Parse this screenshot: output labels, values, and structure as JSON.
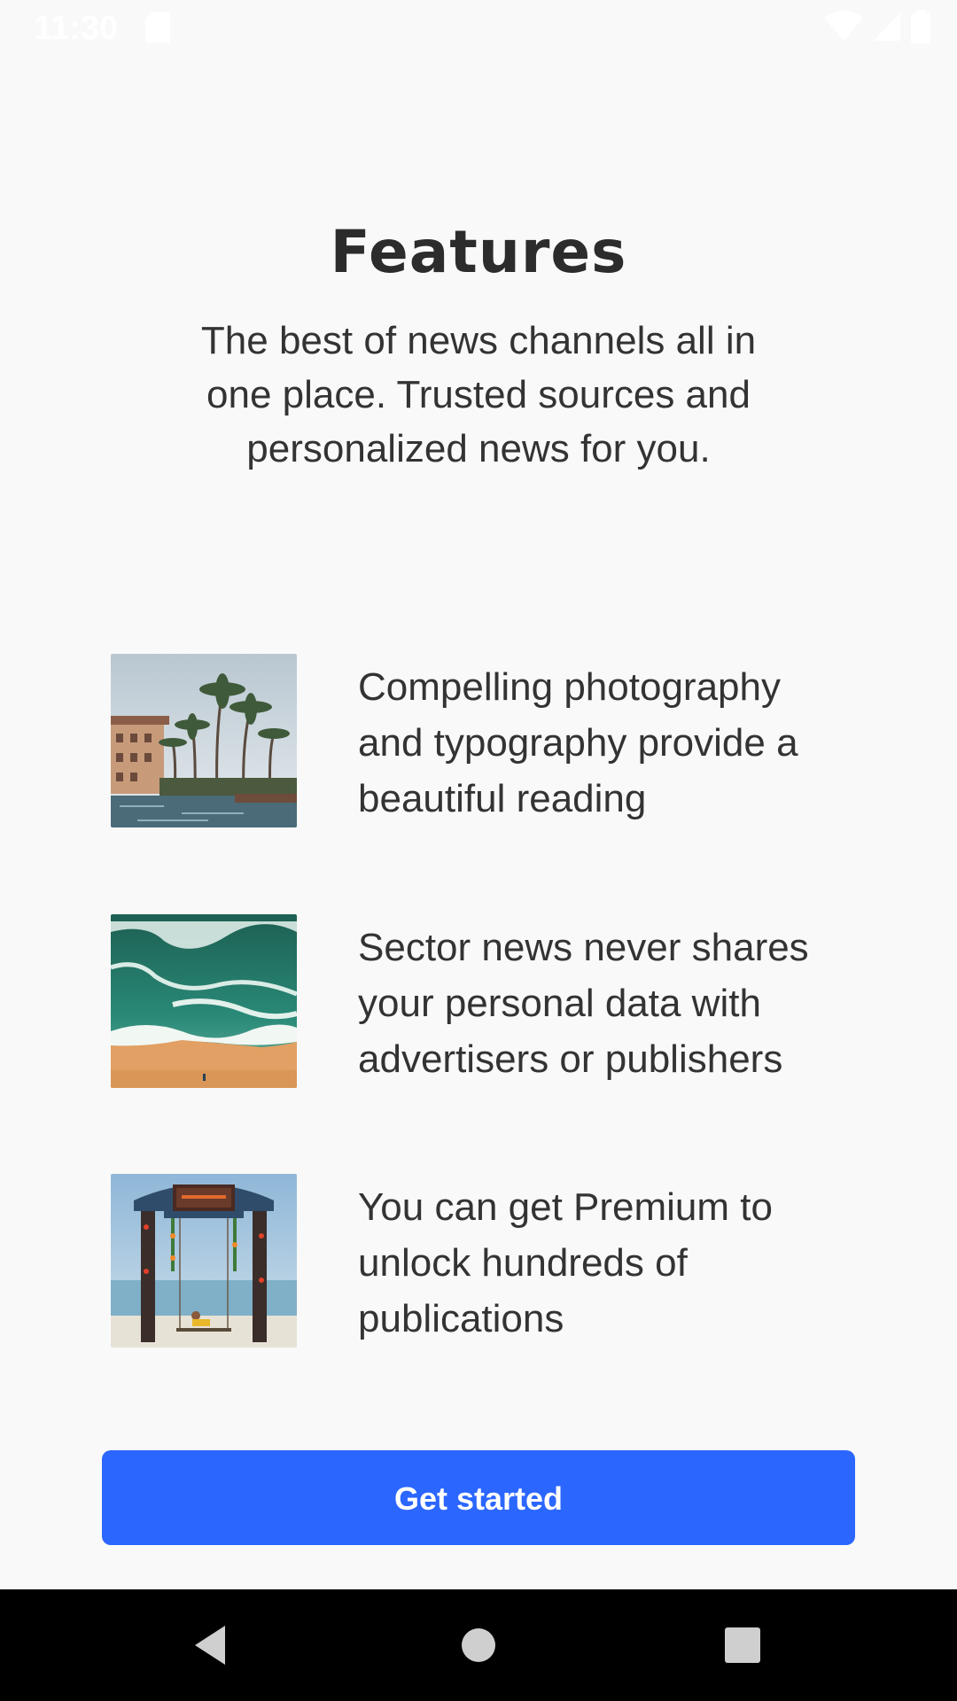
{
  "status_bar": {
    "time": "11:30",
    "icons": [
      "sd-card-icon",
      "wifi-icon",
      "signal-icon",
      "battery-icon"
    ]
  },
  "header": {
    "title": "Features",
    "subtitle": "The best of news channels all in one place. Trusted sources and personalized news for you."
  },
  "features": [
    {
      "image": "resort-palms-pool-photo",
      "text": "Compelling photography and typography provide a beautiful reading"
    },
    {
      "image": "aerial-beach-waves-photo",
      "text": "Sector news never shares your personal data with advertisers or publishers"
    },
    {
      "image": "beach-swing-gate-photo",
      "text": "You can get Premium to unlock hundreds of publications"
    }
  ],
  "cta": {
    "label": "Get started",
    "color": "#2b66ff"
  },
  "nav_bar": {
    "icons": [
      "back-icon",
      "home-icon",
      "recents-icon"
    ]
  }
}
